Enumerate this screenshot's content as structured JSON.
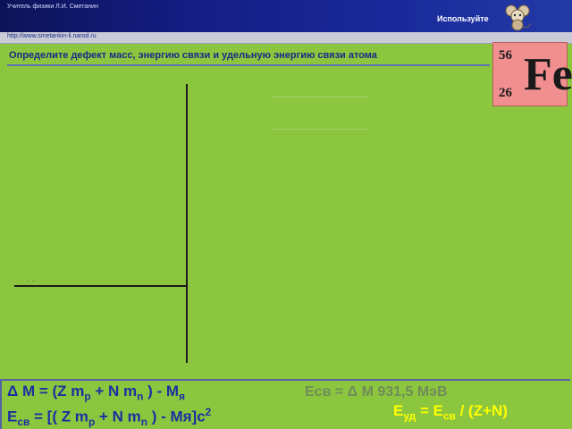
{
  "header": {
    "teacher": "Учитель физики Л.И. Сметанин",
    "use_label": "Используйте",
    "url": "http://www.smetankin-li.narod.ru"
  },
  "task": {
    "text": "Определите  дефект масс, энергию связи и удельную энергию связи атома"
  },
  "element_tile": {
    "mass_number": "56",
    "atomic_number": "26",
    "symbol": "Fe",
    "color": "#f08e90"
  },
  "diagram": {
    "dots": ". ."
  },
  "formulas": {
    "mass_defect": {
      "p1": "Δ М = (Z m",
      "s1": "p",
      "p2": " + N m",
      "s2": "n",
      "p3": " ) - М",
      "s3": "я"
    },
    "binding_energy": {
      "p1": "Е",
      "s1": "св",
      "p2": " = [( Z m",
      "s2": "p",
      "p3": " + N m",
      "s3": "n",
      "p4": " ) - Мя]c",
      "sup": "2"
    },
    "binding_energy_mev": "Есв  = Δ М 931,5 МэВ",
    "specific_energy": {
      "p1": "Е",
      "s1": "уд",
      "p2": " = Е",
      "s2": "св",
      "p3": " / (Z+N)"
    }
  },
  "colors": {
    "background": "#8cc63f",
    "header": "#141e86",
    "formula_blue": "#1c2fa0",
    "formula_yellow": "#ffff00"
  }
}
